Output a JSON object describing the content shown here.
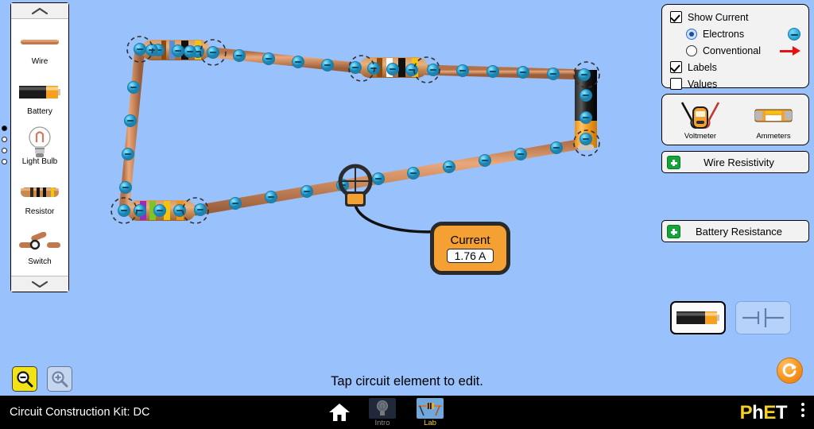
{
  "app": {
    "title": "Circuit Construction Kit: DC",
    "status_text": "Tap circuit element to edit.",
    "background_color": "#99c1fc"
  },
  "toolbox": {
    "scroll_up_icon": "chevron-up-icon",
    "scroll_down_icon": "chevron-down-icon",
    "items": [
      {
        "label": "Wire",
        "icon": "wire-icon"
      },
      {
        "label": "Battery",
        "icon": "battery-icon"
      },
      {
        "label": "Light Bulb",
        "icon": "light-bulb-icon"
      },
      {
        "label": "Resistor",
        "icon": "resistor-icon"
      },
      {
        "label": "Switch",
        "icon": "switch-icon"
      }
    ]
  },
  "display_panel": {
    "show_current": {
      "label": "Show Current",
      "checked": true
    },
    "current_type": {
      "selected": "Electrons",
      "options": [
        {
          "label": "Electrons",
          "selected": true,
          "icon": "electron-icon"
        },
        {
          "label": "Conventional",
          "selected": false,
          "icon": "arrow-right-icon"
        }
      ]
    },
    "labels": {
      "label": "Labels",
      "checked": true
    },
    "values": {
      "label": "Values",
      "checked": false
    }
  },
  "sensor_panel": {
    "voltmeter": {
      "label": "Voltmeter",
      "icon": "voltmeter-icon"
    },
    "ammeters": {
      "label": "Ammeters",
      "icon": "ammeter-icon"
    }
  },
  "accordions": [
    {
      "label": "Wire Resistivity",
      "expand_icon": "plus-icon"
    },
    {
      "label": "Battery Resistance",
      "expand_icon": "plus-icon"
    }
  ],
  "view_toggle": {
    "lifelike": {
      "icon": "battery-lifelike-icon",
      "selected": true
    },
    "schematic": {
      "icon": "battery-schematic-icon",
      "selected": false
    }
  },
  "ammeter_readout": {
    "title": "Current",
    "value": "1.76 A"
  },
  "zoom_controls": {
    "zoom_out": {
      "icon": "zoom-out-icon",
      "active": true
    },
    "zoom_in": {
      "icon": "zoom-in-icon",
      "active": false
    }
  },
  "reset_all": {
    "icon": "reset-icon"
  },
  "navbar": {
    "home_icon": "home-icon",
    "tabs": [
      {
        "label": "Intro",
        "active": false
      },
      {
        "label": "Lab",
        "active": true
      }
    ],
    "logo": "PhET",
    "menu_icon": "kebab-menu-icon"
  },
  "zoom_radio_strip": [
    {
      "selected": true
    },
    {
      "selected": false
    },
    {
      "selected": false
    },
    {
      "selected": false
    }
  ],
  "circuit": {
    "components": [
      {
        "type": "resistor",
        "name": "resistor-top-left",
        "bands": [
          "#8a4b12",
          "#5b8fd6",
          "#111111",
          "#f2c40c"
        ]
      },
      {
        "type": "resistor",
        "name": "resistor-top-middle",
        "bands": [
          "#8a4b12",
          "#ffffff",
          "#111111",
          "#f2c40c"
        ]
      },
      {
        "type": "resistor",
        "name": "resistor-bottom-left",
        "bands": [
          "#9b27c9",
          "#7ec427",
          "#f2c40c",
          "#f2940c"
        ]
      },
      {
        "type": "battery",
        "name": "battery-right"
      },
      {
        "type": "ammeter-probe",
        "name": "ammeter-probe"
      }
    ],
    "wire_color": "#c98a5e",
    "electron_color": "#3cb4e0"
  }
}
